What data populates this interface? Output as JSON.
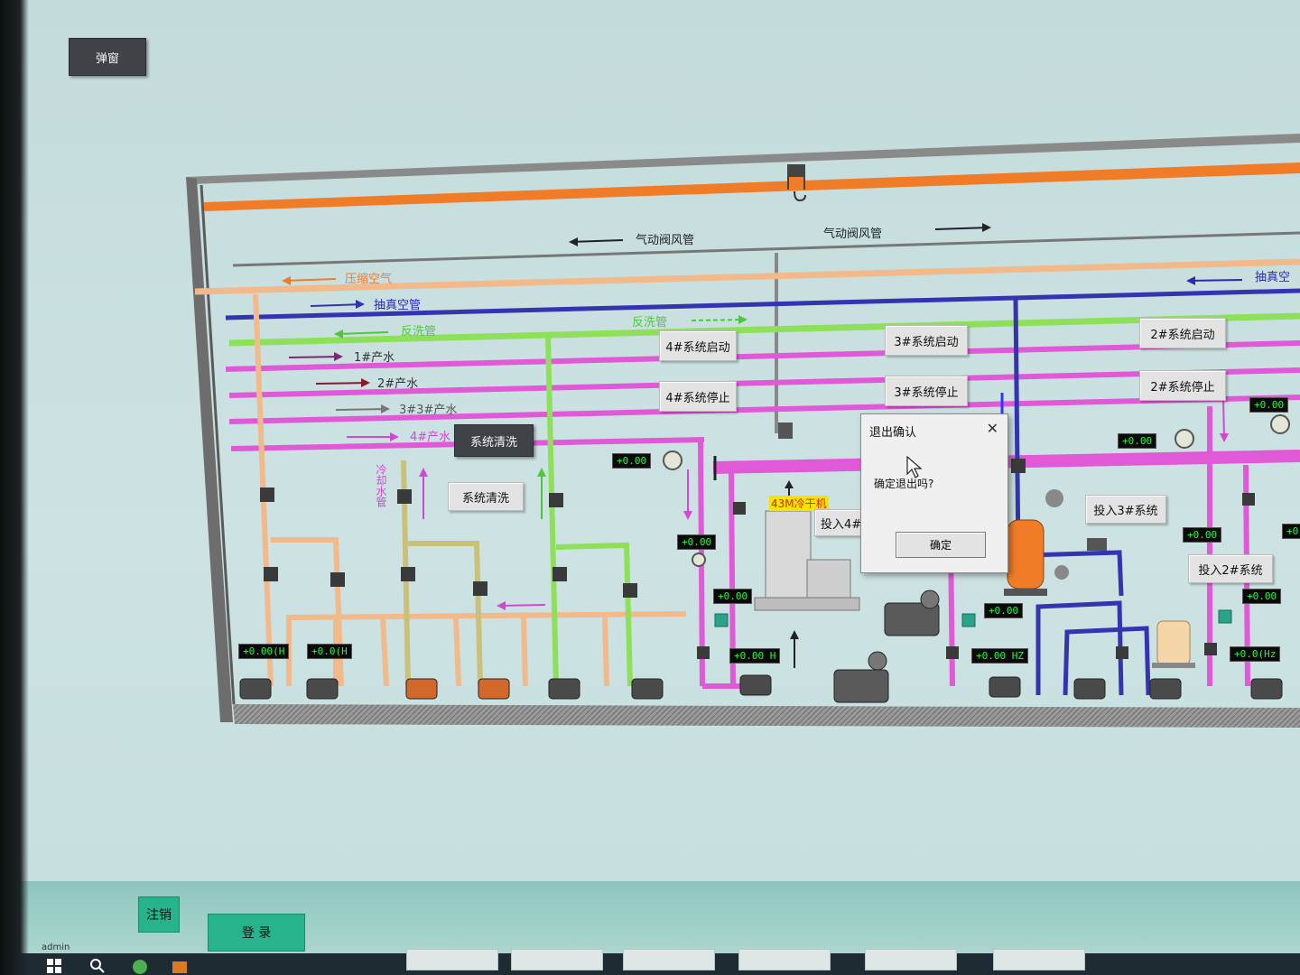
{
  "toolbar": {
    "popup_button": "弹窗"
  },
  "pipes": {
    "air_valve_left": "气动阀风管",
    "air_valve_right": "气动阀风管",
    "compressed_air": "压缩空气",
    "vacuum_left": "抽真空管",
    "vacuum_right": "抽真空",
    "backwash": "反洗管",
    "backwash_right": "反洗管",
    "product_water_1": "1#产水",
    "product_water_2": "2#产水",
    "product_water_3": "3#3#产水",
    "product_water_4": "4#产水",
    "cooling_water": "冷却水管",
    "dryer": "43M冷干机"
  },
  "controls": {
    "system_wash_dark": "系统清洗",
    "system_wash": "系统清洗",
    "sys4_start": "4#系统启动",
    "sys4_stop": "4#系统停止",
    "sys3_start": "3#系统启动",
    "sys3_stop": "3#系统停止",
    "sys2_start": "2#系统启动",
    "sys2_stop": "2#系统停止",
    "engage_sys4": "投入4#系",
    "engage_sys3": "投入3#系统",
    "engage_sys2": "投入2#系统"
  },
  "displays": {
    "d1": "+0.00(H",
    "d2": "+0.0(H",
    "d3": "+0.00",
    "d4": "+0.00",
    "d5": "+0.00",
    "d6": "+0.00 H",
    "d7": "+0.00",
    "d8": "+0.00 HZ",
    "d9": "+0.00",
    "d10": "+0.00",
    "d11": "+0.00",
    "d12": "+0.00",
    "d13": "+0.0(Hz",
    "d14": "+0"
  },
  "dialog": {
    "title": "退出确认",
    "message": "确定退出吗?",
    "ok_label": "确定"
  },
  "footer": {
    "logout_label": "注销",
    "login_label": "登 录",
    "user": "admin"
  },
  "colors": {
    "orange_pipe": "#f07c28",
    "vacuum_pipe": "#3434b0",
    "backwash_pipe": "#8ee05a",
    "product_pipe": "#e05ad8",
    "feed_pipe": "#f2b98a",
    "olive_pipe": "#c9c07a",
    "teal_button": "#27b38c"
  }
}
